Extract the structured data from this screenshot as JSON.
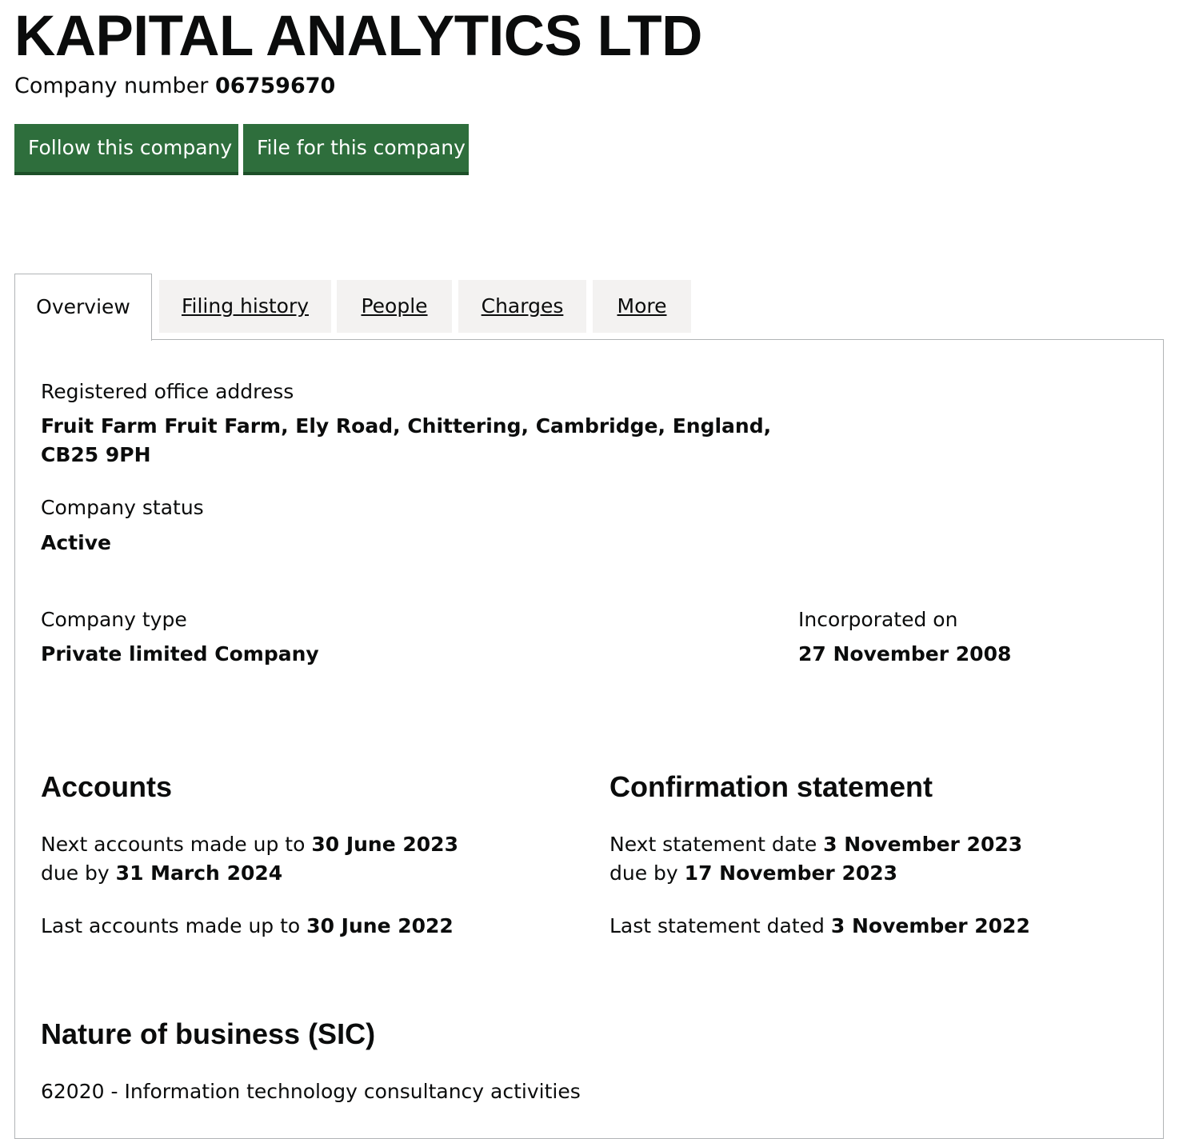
{
  "company": {
    "name": "KAPITAL ANALYTICS LTD",
    "number_label": "Company number",
    "number": "06759670"
  },
  "actions": {
    "follow_label": "Follow this company",
    "file_label": "File for this company"
  },
  "tabs": [
    {
      "label": "Overview",
      "active": true
    },
    {
      "label": "Filing history",
      "active": false
    },
    {
      "label": "People",
      "active": false
    },
    {
      "label": "Charges",
      "active": false
    },
    {
      "label": "More",
      "active": false
    }
  ],
  "overview": {
    "registered_office": {
      "label": "Registered office address",
      "line1": "Fruit Farm Fruit Farm, Ely Road, Chittering, Cambridge, England,",
      "line2": "CB25 9PH"
    },
    "status": {
      "label": "Company status",
      "value": "Active"
    },
    "type": {
      "label": "Company type",
      "value": "Private limited Company"
    },
    "incorporated": {
      "label": "Incorporated on",
      "value": "27 November 2008"
    }
  },
  "accounts": {
    "heading": "Accounts",
    "next_label": "Next accounts made up to",
    "next_value": "30 June 2023",
    "due_label": "due by",
    "due_value": "31 March 2024",
    "last_label": "Last accounts made up to",
    "last_value": "30 June 2022"
  },
  "confirmation": {
    "heading": "Confirmation statement",
    "next_label": "Next statement date",
    "next_value": "3 November 2023",
    "due_label": "due by",
    "due_value": "17 November 2023",
    "last_label": "Last statement dated",
    "last_value": "3 November 2022"
  },
  "sic": {
    "heading": "Nature of business (SIC)",
    "item": "62020 - Information technology consultancy activities"
  },
  "colors": {
    "button_green": "#2e6e3c",
    "tab_grey": "#f3f2f1",
    "border_grey": "#b1b4b6",
    "text": "#0b0c0c"
  }
}
